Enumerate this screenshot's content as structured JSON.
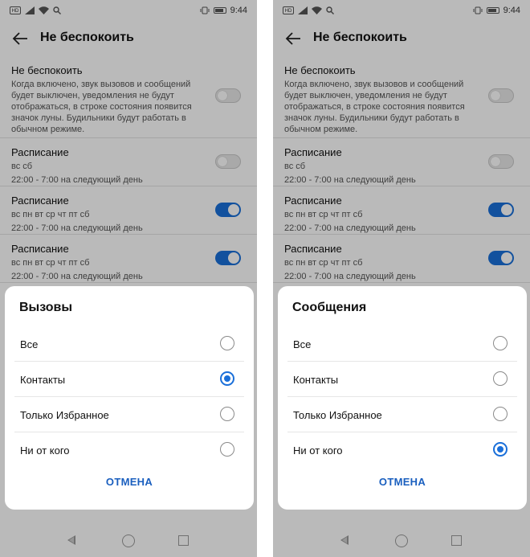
{
  "statusbar": {
    "time": "9:44",
    "hd": "HD"
  },
  "appbar": {
    "title": "Не беспокоить"
  },
  "settings": {
    "dnd": {
      "title": "Не беспокоить",
      "description": "Когда включено, звук вызовов и сообщений будет выключен, уведомления не будут отображаться, в строке состояния появится значок луны. Будильники будут работать в обычном режиме.",
      "enabled": false
    },
    "schedules": [
      {
        "title": "Расписание",
        "days": "вс сб",
        "time": "22:00 - 7:00 на следующий день",
        "enabled": false
      },
      {
        "title": "Расписание",
        "days": "вс пн вт ср чт пт сб",
        "time": "22:00 - 7:00 на следующий день",
        "enabled": true
      },
      {
        "title": "Расписание",
        "days": "вс пн вт ср чт пт сб",
        "time": "22:00 - 7:00 на следующий день",
        "enabled": true
      }
    ]
  },
  "dialogs": [
    {
      "title": "Вызовы",
      "options": [
        "Все",
        "Контакты",
        "Только Избранное",
        "Ни от кого"
      ],
      "selected": "Контакты",
      "cancel_label": "ОТМЕНА"
    },
    {
      "title": "Сообщения",
      "options": [
        "Все",
        "Контакты",
        "Только Избранное",
        "Ни от кого"
      ],
      "selected": "Ни от кого",
      "cancel_label": "ОТМЕНА"
    }
  ],
  "colors": {
    "accent": "#1a6fd9",
    "button_text": "#1a5fbf",
    "scrim": "rgba(0,0,0,0.27)"
  },
  "icons": {
    "status_left": [
      "hd-icon",
      "signal-icon",
      "wifi-icon",
      "search-icon"
    ],
    "status_right": [
      "vibrate-icon",
      "battery-icon"
    ],
    "appbar": "back-arrow-icon",
    "navbar": [
      "nav-back-icon",
      "nav-home-icon",
      "nav-recent-icon"
    ]
  }
}
